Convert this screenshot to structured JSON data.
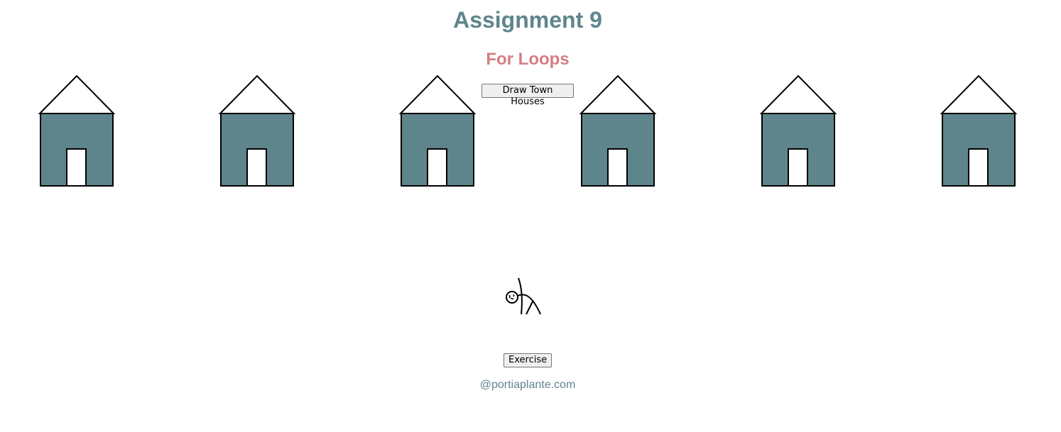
{
  "header": {
    "title": "Assignment 9",
    "subtitle": "For Loops"
  },
  "buttons": {
    "draw_houses_label": "Draw Town Houses",
    "exercise_label": "Exercise"
  },
  "footer": {
    "handle": "@portiaplante.com"
  },
  "colors": {
    "title": "#5f858c",
    "subtitle": "#d47e82",
    "house_body": "#5f858c",
    "door": "#ffffff",
    "outline": "#000000"
  },
  "houses": {
    "count": 6
  },
  "icons": {
    "exercise_figure": "stretching-stick-figure-icon"
  }
}
